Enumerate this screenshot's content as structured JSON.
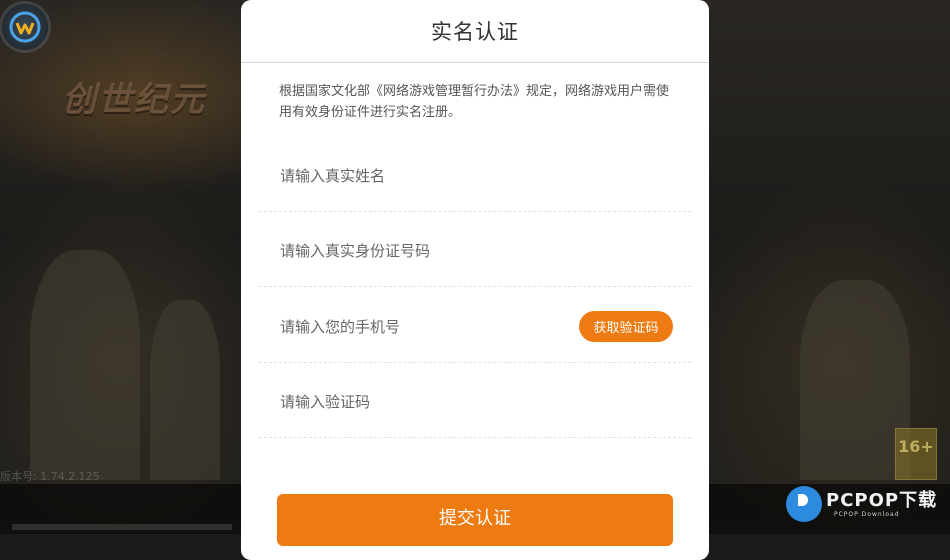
{
  "game": {
    "title": "创世纪元",
    "version": "版本号: 1.74.2.125"
  },
  "dialog": {
    "title": "实名认证",
    "notice": "根据国家文化部《网络游戏管理暂行办法》规定，网络游戏用户需使用有效身份证件进行实名注册。",
    "fields": {
      "name_placeholder": "请输入真实姓名",
      "id_placeholder": "请输入真实身份证号码",
      "phone_placeholder": "请输入您的手机号",
      "code_placeholder": "请输入验证码"
    },
    "get_code_label": "获取验证码",
    "submit_label": "提交认证"
  },
  "overlay": {
    "age_rating": "16+",
    "watermark_main": "PCPOP下载",
    "watermark_sub": "PCPOP Download"
  },
  "colors": {
    "accent": "#ee7b12",
    "dialog_bg": "#ffffff"
  },
  "icons": [
    "app-logo-icon",
    "pcpop-logo-icon"
  ]
}
